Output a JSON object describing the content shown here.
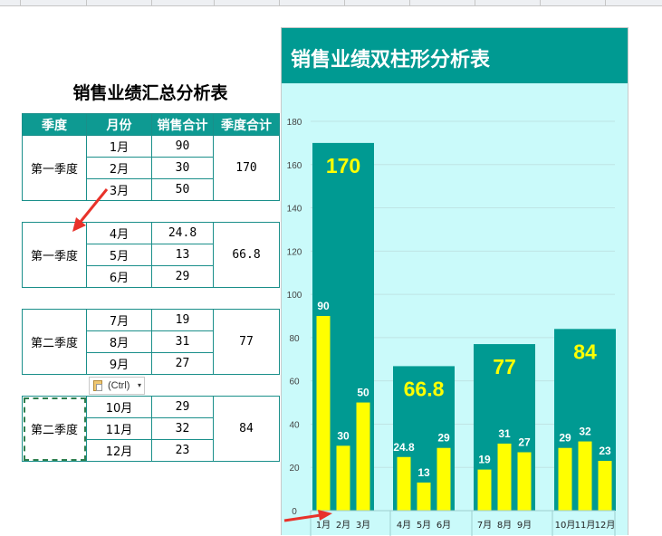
{
  "sheet": {
    "title": "销售业绩汇总分析表",
    "headers": [
      "季度",
      "月份",
      "销售合计",
      "季度合计"
    ],
    "blocks": [
      {
        "quarter": "第一季度",
        "total": "170",
        "rows": [
          {
            "month": "1月",
            "sales": "90"
          },
          {
            "month": "2月",
            "sales": "30"
          },
          {
            "month": "3月",
            "sales": "50"
          }
        ]
      },
      {
        "quarter": "第一季度",
        "total": "66.8",
        "rows": [
          {
            "month": "4月",
            "sales": "24.8"
          },
          {
            "month": "5月",
            "sales": "13"
          },
          {
            "month": "6月",
            "sales": "29"
          }
        ]
      },
      {
        "quarter": "第二季度",
        "total": "77",
        "rows": [
          {
            "month": "7月",
            "sales": "19"
          },
          {
            "month": "8月",
            "sales": "31"
          },
          {
            "month": "9月",
            "sales": "27"
          }
        ]
      },
      {
        "quarter": "第二季度",
        "total": "84",
        "rows": [
          {
            "month": "10月",
            "sales": "29"
          },
          {
            "month": "11月",
            "sales": "32"
          },
          {
            "month": "12月",
            "sales": "23"
          }
        ]
      }
    ],
    "paste_options_label": "(Ctrl)"
  },
  "colors": {
    "teal": "#009a92",
    "chart_bg": "#cafafa",
    "month_bar": "#ffff00",
    "quarter_label": "#ffff00",
    "arrow": "#e8322a"
  },
  "icons": [
    "clipboard-icon",
    "dropdown-arrow-icon",
    "red-arrow-icon"
  ],
  "chart_data": {
    "type": "bar",
    "title": "销售业绩双柱形分析表",
    "ylim": [
      0,
      180
    ],
    "yticks": [
      0,
      20,
      40,
      60,
      80,
      100,
      120,
      140,
      160,
      180
    ],
    "grid": true,
    "groups": [
      {
        "label": "第一季度",
        "total": 170,
        "months": [
          "1月",
          "2月",
          "3月"
        ],
        "values": [
          90,
          30,
          50
        ]
      },
      {
        "label": "第一季度",
        "total": 66.8,
        "months": [
          "4月",
          "5月",
          "6月"
        ],
        "values": [
          24.8,
          13,
          29
        ]
      },
      {
        "label": "第二季度",
        "total": 77,
        "months": [
          "7月",
          "8月",
          "9月"
        ],
        "values": [
          19,
          31,
          27
        ]
      },
      {
        "label": "第二季度",
        "total": 84,
        "months": [
          "10月",
          "11月",
          "12月"
        ],
        "values": [
          29,
          32,
          23
        ]
      }
    ]
  }
}
